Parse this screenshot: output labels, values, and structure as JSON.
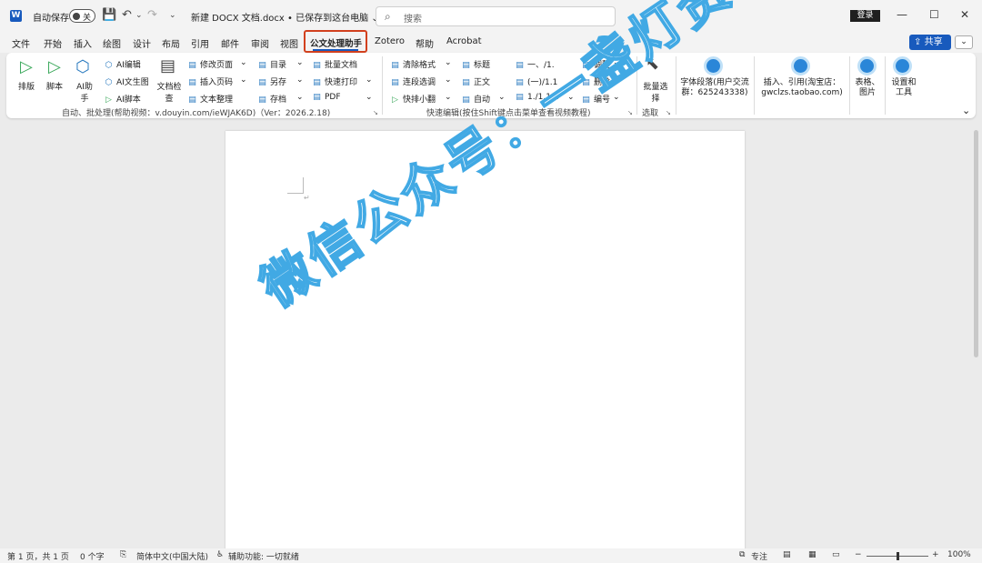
{
  "titlebar": {
    "app_icon": "W",
    "autosave_label": "自动保存",
    "autosave_state": "关",
    "doc_title": "新建 DOCX 文档.docx • 已保存到这台电脑",
    "title_caret": "⌄",
    "search_placeholder": "搜索",
    "login": "登录",
    "icons": {
      "save": "save-icon",
      "undo": "undo-icon",
      "redo": "redo-icon",
      "customize": "customize-icon"
    },
    "save_glyph": "💾",
    "undo_glyph": "↶",
    "undo_caret": "⌄",
    "redo_glyph": "↷",
    "customize_glyph": "⌄",
    "search_glyph": "⌕",
    "minimize": "—",
    "maximize": "☐",
    "close": "✕"
  },
  "tabs": [
    "文件",
    "开始",
    "插入",
    "绘图",
    "设计",
    "布局",
    "引用",
    "邮件",
    "审阅",
    "视图",
    "公文处理助手",
    "Zotero",
    "帮助",
    "Acrobat"
  ],
  "active_tab": "公文处理助手",
  "share": {
    "label": "共享",
    "glyph": "⇪",
    "caret": "⌄"
  },
  "ribbon": {
    "big": {
      "paiban": "排版",
      "jiaoben": "脚本",
      "ai_helper": "AI助手",
      "doc_check": "文档检查",
      "batch_select": "批量选择",
      "font_group": "字体段落(用户交流群：625243338)",
      "insert_ref": "插入、引用(淘宝店：gwclzs.taobao.com)",
      "table_image": "表格、图片",
      "settings_tools": "设置和工具"
    },
    "col1": [
      "AI编辑",
      "AI文生图",
      "AI脚本"
    ],
    "col2": [
      "修改页面",
      "插入页码",
      "文本整理"
    ],
    "col3": [
      "目录",
      "另存",
      "存档"
    ],
    "col4": [
      "批量文档",
      "快速打印",
      "PDF"
    ],
    "col5": [
      "清除格式",
      "连段选调",
      "快排小翻"
    ],
    "col6": [
      "标题",
      "正文",
      "自动"
    ],
    "col7": [
      "一、/1.",
      "(一)/1.1",
      "1./1.1.1"
    ],
    "col8": [
      "调整",
      "删除",
      "编号"
    ],
    "group_labels": {
      "auto": "自动、批处理(帮助视频：v.douyin.com/ieWJAK6D)（Ver：2026.2.18)",
      "quick": "快速编辑(按住Shift键点击菜单查看视频教程)",
      "select": "选取"
    },
    "glyphs": {
      "play": "▷",
      "ai": "⬡",
      "doc": "▤",
      "select_arrow": "⬉",
      "caret": "⌄",
      "launcher": "↘",
      "ribbon_collapse": "⌄",
      "para_mark": "↵"
    }
  },
  "document": {
    "watermark": "微信公众号：一盏灯资源库"
  },
  "statusbar": {
    "page": "第 1 页，共 1 页",
    "words": "0 个字",
    "language": "简体中文(中国大陆)",
    "accessibility": "辅助功能: 一切就绪",
    "focus": "专注",
    "zoom": "100%",
    "icons": {
      "proof": "proof-icon",
      "accessibility": "accessibility-icon"
    },
    "proof_glyph": "⎘",
    "access_glyph": "♿",
    "focus_glyph": "⧉",
    "read_glyph": "▤",
    "print_glyph": "▦",
    "web_glyph": "▭",
    "zoom_minus": "−",
    "zoom_plus": "+"
  }
}
